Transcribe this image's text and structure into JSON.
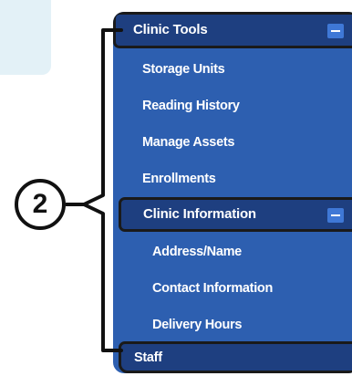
{
  "callout": {
    "number": "2"
  },
  "menu": {
    "section_clinic_tools": "Clinic Tools",
    "items_tools": [
      "Storage Units",
      "Reading History",
      "Manage Assets",
      "Enrollments"
    ],
    "section_clinic_information": "Clinic Information",
    "items_information": [
      "Address/Name",
      "Contact Information",
      "Delivery Hours"
    ],
    "staff": "Staff"
  },
  "colors": {
    "panel": "#2d5fb0",
    "section_header": "#1e3f80",
    "collapse_button": "#3f78d6",
    "annotation": "#111111"
  }
}
